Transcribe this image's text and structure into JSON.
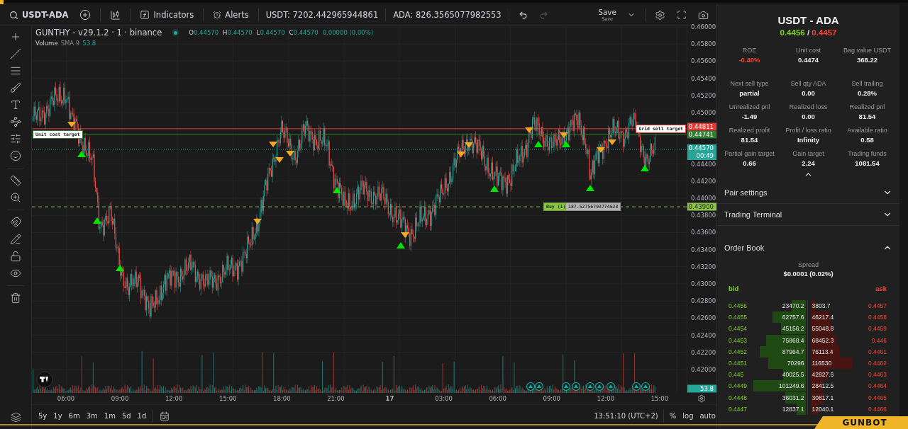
{
  "toolbar": {
    "symbol": "USDT-ADA",
    "indicators": "Indicators",
    "alerts": "Alerts",
    "balances": [
      "USDT: 7202.442965944861",
      "ADA: 826.3565077982553"
    ],
    "save": "Save",
    "save_sub": "Save"
  },
  "legend": {
    "title": "GUNTHY - v29.1.2 · 1 · binance",
    "ohlc": [
      {
        "key": "O",
        "value": "0.44570"
      },
      {
        "key": "H",
        "value": "0.44570"
      },
      {
        "key": "L",
        "value": "0.44570"
      },
      {
        "key": "C",
        "value": "0.44570"
      }
    ],
    "change": "0.00000 (0.00%)",
    "volume_label": "Volume",
    "sma_label": "SMA 9",
    "sma_value": "53.8"
  },
  "price_axis": [
    "0.46000",
    "0.45800",
    "0.45600",
    "0.45400",
    "0.45200",
    "0.45000",
    "0.44400",
    "0.44200",
    "0.44000",
    "0.43800",
    "0.43600",
    "0.43400",
    "0.43200",
    "0.43000",
    "0.42800",
    "0.42600",
    "0.42400",
    "0.42200",
    "0.42000"
  ],
  "price_lines": [
    {
      "kind": "target",
      "label": "Grid sell target",
      "price": "0.44811",
      "color": "#e53935"
    },
    {
      "kind": "target",
      "label": "Unit cost target",
      "price": "0.44741",
      "color": "#2e7d32"
    },
    {
      "kind": "current",
      "price": "0.44570",
      "countdown": "00:49",
      "color": "#26a69a"
    },
    {
      "kind": "order",
      "label": "Buy (1)",
      "amount": "187.52756793774628",
      "price": "0.43900",
      "color": "#8bc34a"
    }
  ],
  "volume_badge": "53.8",
  "time_axis": [
    {
      "label": "06:00",
      "bold": false
    },
    {
      "label": "09:00",
      "bold": false
    },
    {
      "label": "12:00",
      "bold": false
    },
    {
      "label": "15:00",
      "bold": false
    },
    {
      "label": "18:00",
      "bold": false
    },
    {
      "label": "21:00",
      "bold": false
    },
    {
      "label": "17",
      "bold": true
    },
    {
      "label": "03:00",
      "bold": false
    },
    {
      "label": "06:00",
      "bold": false
    },
    {
      "label": "09:00",
      "bold": false
    },
    {
      "label": "12:00",
      "bold": false
    },
    {
      "label": "15:00",
      "bold": false
    }
  ],
  "ranges": [
    "5y",
    "1y",
    "6m",
    "3m",
    "1m",
    "5d",
    "1d"
  ],
  "clock": "13:51:10 (UTC+2)",
  "scale_options": [
    "%",
    "log",
    "auto"
  ],
  "panel": {
    "pair": "USDT - ADA",
    "bid": "0.4456",
    "separator": "/",
    "ask": "0.4457",
    "stats": [
      {
        "label": "ROE",
        "value": "-0.40%",
        "negative": true
      },
      {
        "label": "Unit cost",
        "value": "0.4474",
        "negative": false
      },
      {
        "label": "Bag value USDT",
        "value": "368.22",
        "negative": false
      },
      {
        "label": "Next sell type",
        "value": "partial",
        "negative": false
      },
      {
        "label": "Sell qty ADA",
        "value": "0.00",
        "negative": false
      },
      {
        "label": "Sell trailing",
        "value": "0.28%",
        "negative": false
      },
      {
        "label": "Unrealized pnl",
        "value": "-1.49",
        "negative": false
      },
      {
        "label": "Realized loss",
        "value": "0.00",
        "negative": false
      },
      {
        "label": "Realized pnl",
        "value": "81.54",
        "negative": false
      },
      {
        "label": "Realized profit",
        "value": "81.54",
        "negative": false
      },
      {
        "label": "Profit / loss ratio",
        "value": "Infinity",
        "negative": false
      },
      {
        "label": "Available ratio",
        "value": "0.58",
        "negative": false
      },
      {
        "label": "Partial gain target",
        "value": "0.66",
        "negative": false
      },
      {
        "label": "Gain target",
        "value": "2.24",
        "negative": false
      },
      {
        "label": "Trading funds",
        "value": "1081.54",
        "negative": false
      }
    ],
    "sections": [
      {
        "title": "Pair settings",
        "expanded": false
      },
      {
        "title": "Trading Terminal",
        "expanded": false
      },
      {
        "title": "Order Book",
        "expanded": true
      }
    ],
    "order_book": {
      "spread_label": "Spread",
      "spread": "$0.0001 (0.02%)",
      "bid_label": "bid",
      "ask_label": "ask",
      "rows": [
        {
          "bid": "0.4456",
          "bid_size": "23470.2",
          "ask_size": "3803.7",
          "ask": "0.4457"
        },
        {
          "bid": "0.4455",
          "bid_size": "62757.6",
          "ask_size": "46217.4",
          "ask": "0.4458"
        },
        {
          "bid": "0.4454",
          "bid_size": "45156.2",
          "ask_size": "55048.8",
          "ask": "0.4459"
        },
        {
          "bid": "0.4453",
          "bid_size": "75868.4",
          "ask_size": "68452.3",
          "ask": "0.446"
        },
        {
          "bid": "0.4452",
          "bid_size": "87964.7",
          "ask_size": "76113.4",
          "ask": "0.4461"
        },
        {
          "bid": "0.4451",
          "bid_size": "70296",
          "ask_size": "116530",
          "ask": "0.4462"
        },
        {
          "bid": "0.445",
          "bid_size": "40025.5",
          "ask_size": "42827.6",
          "ask": "0.4463"
        },
        {
          "bid": "0.4449",
          "bid_size": "101249.6",
          "ask_size": "28412.5",
          "ask": "0.4464"
        },
        {
          "bid": "0.4448",
          "bid_size": "36031.2",
          "ask_size": "30817.1",
          "ask": "0.4465"
        },
        {
          "bid": "0.4447",
          "bid_size": "12837.1",
          "ask_size": "12040.1",
          "ask": "0.4466"
        }
      ]
    }
  },
  "brand": "GUNBOT"
}
